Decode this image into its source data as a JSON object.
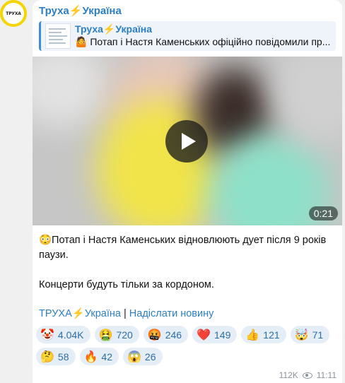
{
  "channel": {
    "logo_text": "ТРУХА",
    "name": "Труха⚡Україна"
  },
  "reply": {
    "name": "Труха⚡Україна",
    "text": "🤷 Потап і Настя Каменських офіційно повідомили пр..."
  },
  "video": {
    "duration": "0:21"
  },
  "post": {
    "line1": "😳Потап і Настя Каменських відновлюють дует після 9 років паузи.",
    "line2": "Концерти будуть тільки за кордоном."
  },
  "links": {
    "channel": "ТРУХА⚡Україна",
    "separator": "|",
    "submit": "Надіслати новину"
  },
  "reactions": [
    {
      "emoji": "🤡",
      "count": "4.04K"
    },
    {
      "emoji": "🤮",
      "count": "720"
    },
    {
      "emoji": "🤬",
      "count": "246"
    },
    {
      "emoji": "❤️",
      "count": "149"
    },
    {
      "emoji": "👍",
      "count": "121"
    },
    {
      "emoji": "🤯",
      "count": "71"
    },
    {
      "emoji": "🤔",
      "count": "58"
    },
    {
      "emoji": "🔥",
      "count": "42"
    },
    {
      "emoji": "😱",
      "count": "26"
    }
  ],
  "meta": {
    "views": "112K",
    "time": "11:11"
  },
  "colors": {
    "accent": "#2b7fc2",
    "reaction_bg": "#e5eef7",
    "logo_ring": "#f5d400"
  }
}
